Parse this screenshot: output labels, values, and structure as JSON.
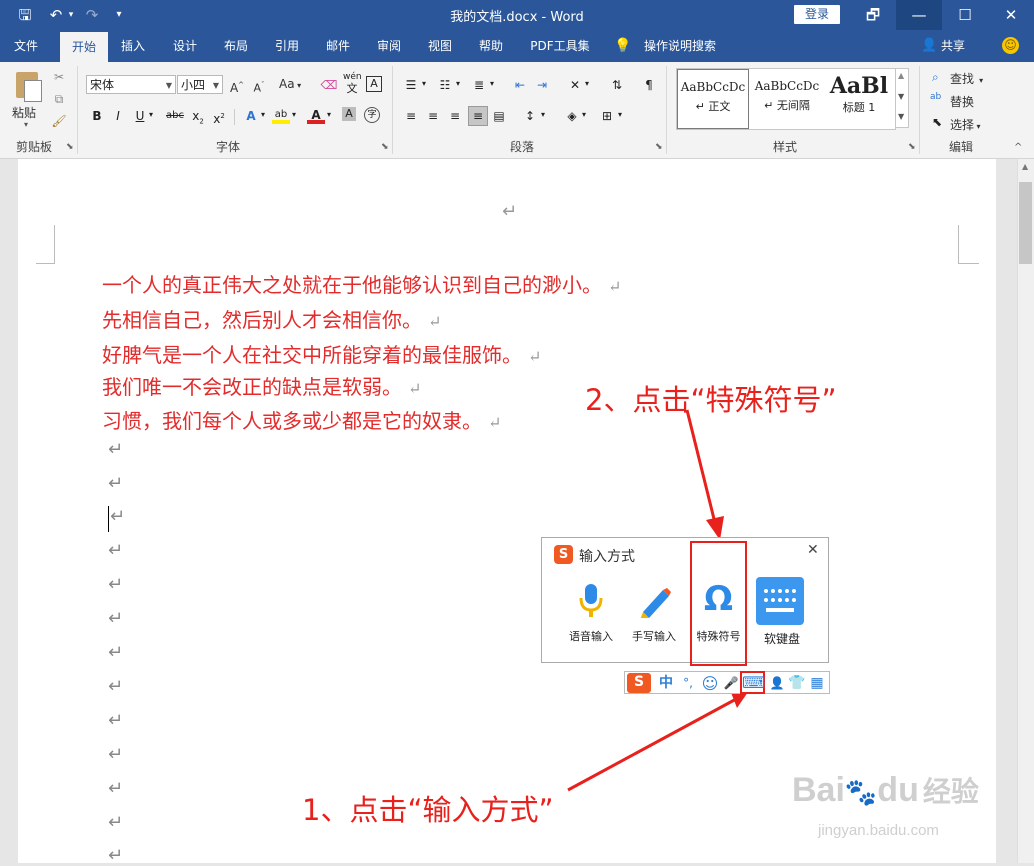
{
  "window": {
    "title": "我的文档.docx  -  Word",
    "login_label": "登录",
    "controls": {
      "restore": "🗗",
      "minimize": "—",
      "maximize": "☐",
      "close": "✕"
    }
  },
  "quick_access": {
    "save": "🖫",
    "undo": "↶",
    "undo_dd": "▾",
    "redo": "↷",
    "customize": "▾"
  },
  "tabs": [
    {
      "label": "文件"
    },
    {
      "label": "开始"
    },
    {
      "label": "插入"
    },
    {
      "label": "设计"
    },
    {
      "label": "布局"
    },
    {
      "label": "引用"
    },
    {
      "label": "邮件"
    },
    {
      "label": "审阅"
    },
    {
      "label": "视图"
    },
    {
      "label": "帮助"
    },
    {
      "label": "PDF工具集"
    },
    {
      "label": "操作说明搜索"
    }
  ],
  "share_label": "共享",
  "ribbon": {
    "clipboard": {
      "paste_label": "粘贴",
      "group_label": "剪贴板"
    },
    "font": {
      "font_name": "宋体",
      "font_size": "小四",
      "group_label": "字体",
      "case_label": "Aa",
      "phonetic_top": "wén",
      "phonetic_bottom": "文"
    },
    "paragraph": {
      "group_label": "段落"
    },
    "styles": {
      "group_label": "样式",
      "items": [
        {
          "sample": "AaBbCcDc",
          "name": "↵ 正文"
        },
        {
          "sample": "AaBbCcDc",
          "name": "↵ 无间隔"
        },
        {
          "sample": "AaBl",
          "name": "标题 1"
        }
      ]
    },
    "editing": {
      "group_label": "编辑",
      "find": "查找",
      "replace": "替换",
      "select": "选择"
    }
  },
  "document": {
    "lines": [
      "一个人的真正伟大之处就在于他能够认识到自己的渺小。",
      "先相信自己，然后别人才会相信你。",
      "好脾气是一个人在社交中所能穿着的最佳服饰。",
      "我们唯一不会改正的缺点是软弱。",
      "习惯，我们每个人或多或少都是它的奴隶。"
    ],
    "return_mark": "↵",
    "text_color": "#e32b2b"
  },
  "ime_popup": {
    "title": "输入方式",
    "close": "✕",
    "items": [
      {
        "label": "语音输入",
        "icon": "microphone-icon"
      },
      {
        "label": "手写输入",
        "icon": "pencil-icon"
      },
      {
        "label": "特殊符号",
        "icon": "omega-icon"
      },
      {
        "label": "软键盘",
        "icon": "keyboard-icon"
      }
    ]
  },
  "ime_bar": {
    "logo": "S",
    "mode": "中",
    "punct": "°,",
    "emoji": "☺",
    "voice": "🎤",
    "keyboard": "⌨",
    "skin": "👕",
    "apps": "▦"
  },
  "annotations": {
    "step1": "1、点击“输入方式”",
    "step2": "2、点击“特殊符号”",
    "color": "#e8211d"
  },
  "watermark": {
    "brand_a": "Bai",
    "brand_b": "du",
    "brand_c": "经验",
    "url": "jingyan.baidu.com"
  }
}
